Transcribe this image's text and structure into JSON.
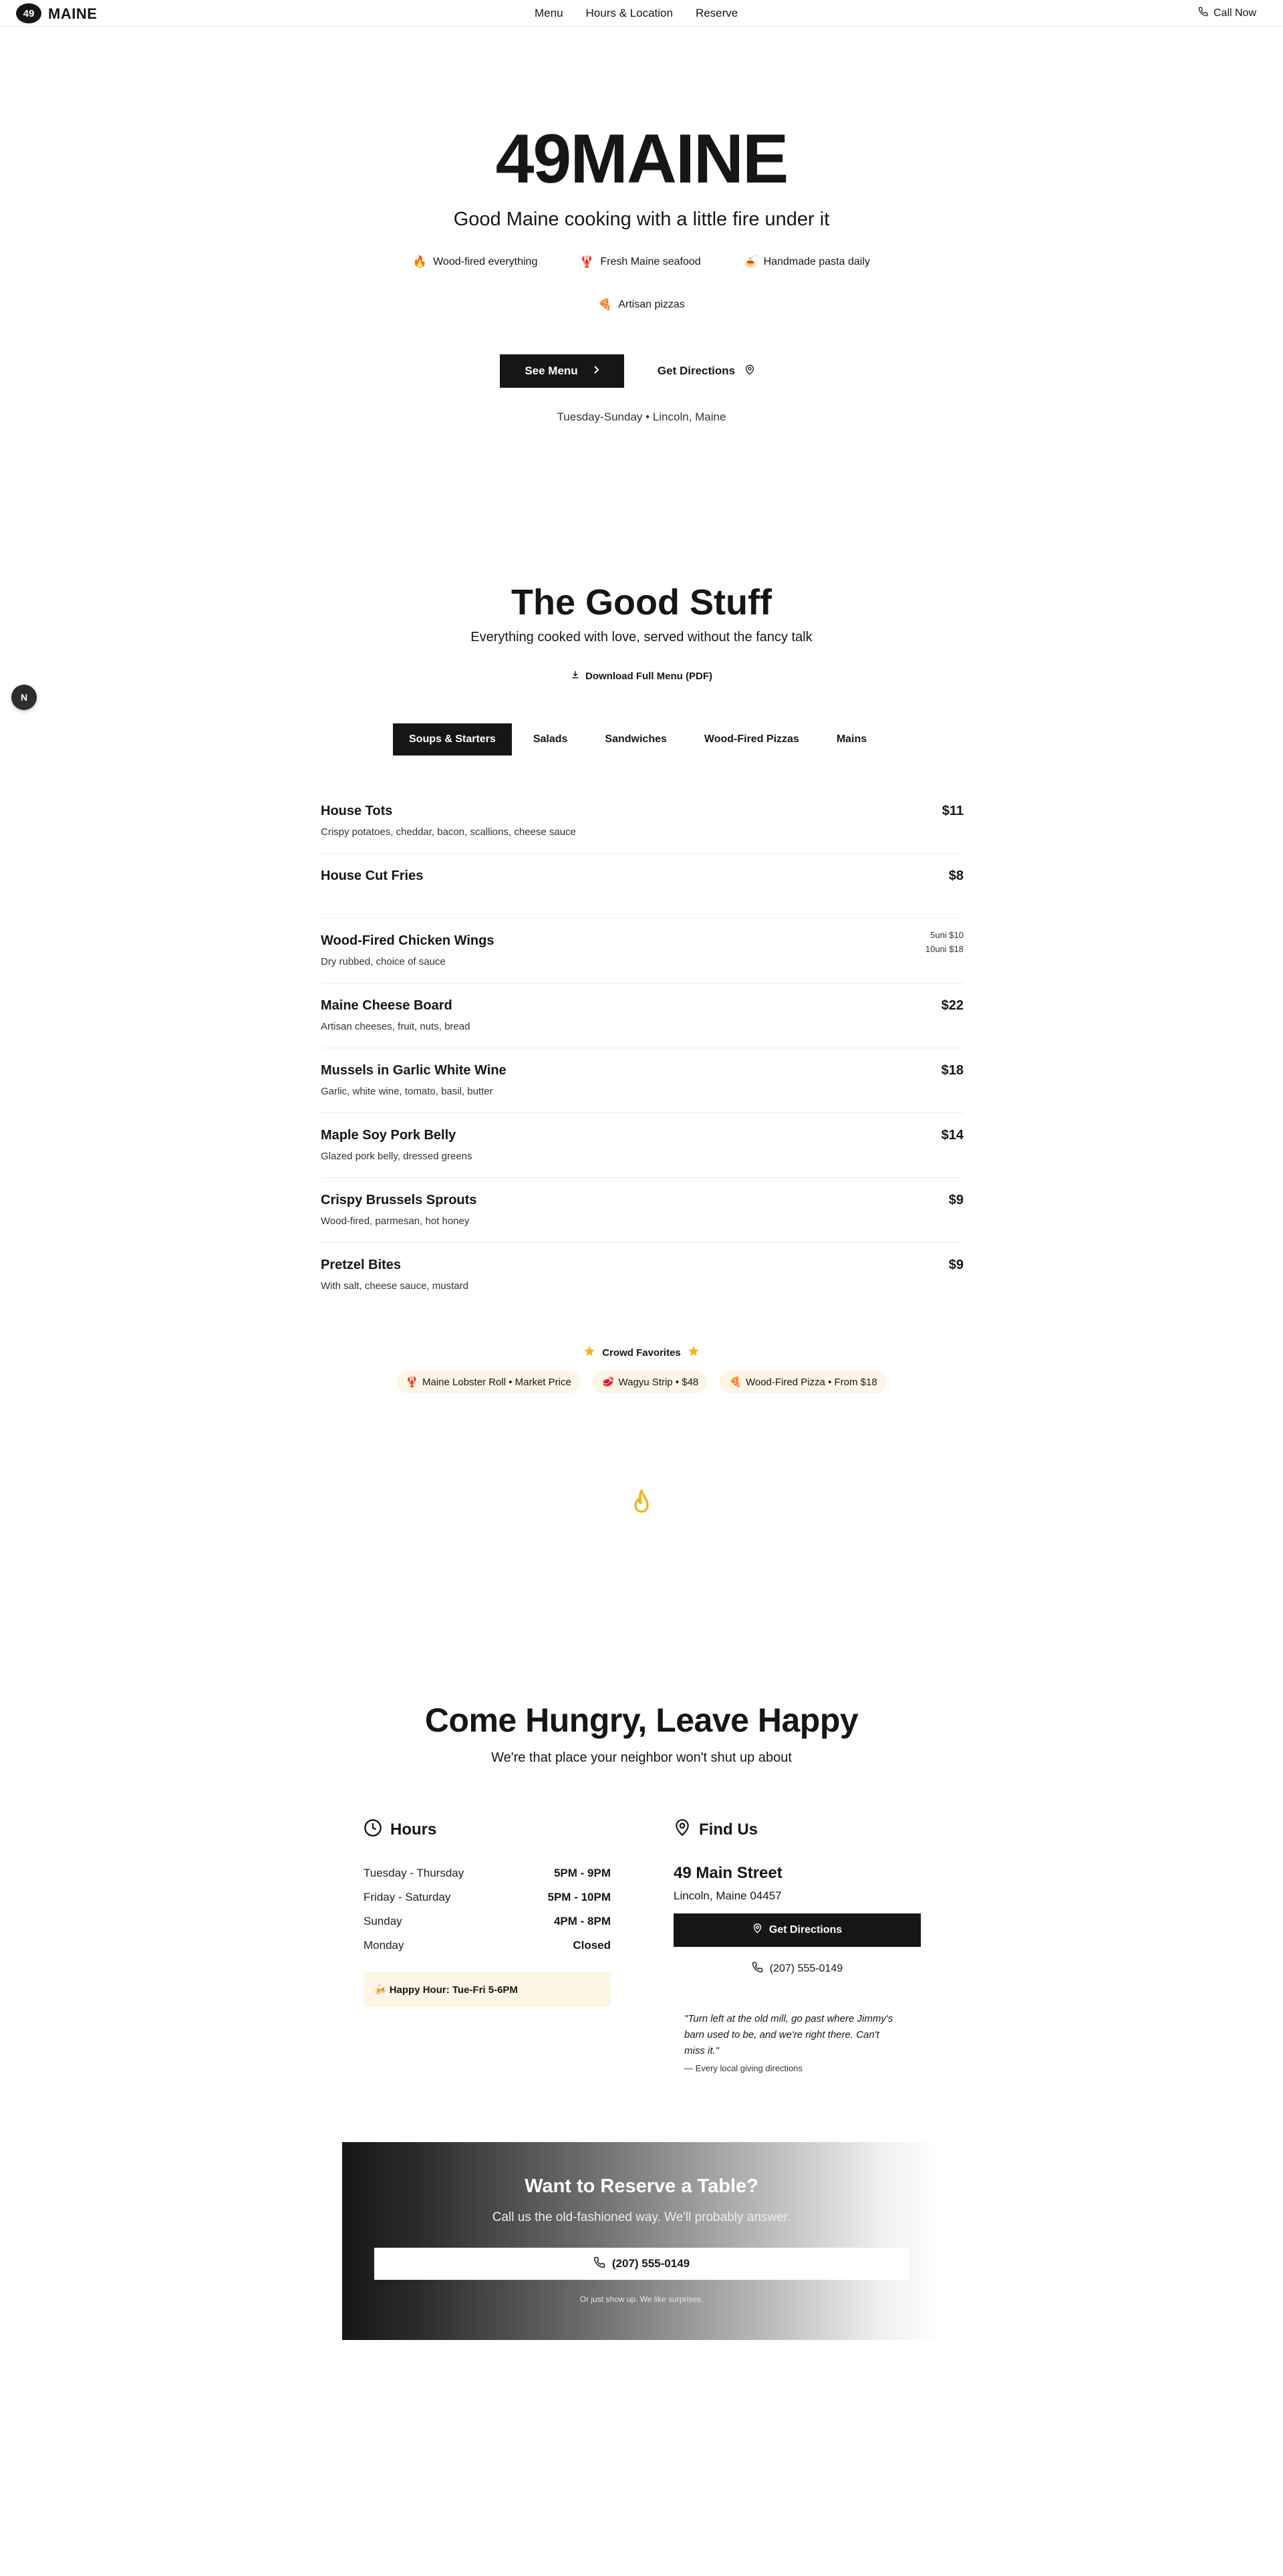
{
  "nav": {
    "logo_badge": "49",
    "logo_text": "MAINE",
    "links": [
      "Menu",
      "Hours & Location",
      "Reserve"
    ],
    "call": "Call Now"
  },
  "hero": {
    "title": "49MAINE",
    "tagline": "Good Maine cooking with a little fire under it",
    "features": [
      {
        "icon": "fire-icon",
        "glyph": "🔥",
        "label": "Wood-fired everything"
      },
      {
        "icon": "lobster-icon",
        "glyph": "🦞",
        "label": "Fresh Maine seafood"
      },
      {
        "icon": "pasta-icon",
        "glyph": "🍝",
        "label": "Handmade pasta daily"
      },
      {
        "icon": "pizza-icon",
        "glyph": "🍕",
        "label": "Artisan pizzas"
      }
    ],
    "see_menu": "See Menu",
    "get_directions": "Get Directions",
    "note": "Tuesday-Sunday • Lincoln, Maine"
  },
  "menu": {
    "title": "The Good Stuff",
    "subtitle": "Everything cooked with love, served without the fancy talk",
    "download": "Download Full Menu (PDF)",
    "side_badge": "N",
    "tabs": [
      "Soups & Starters",
      "Salads",
      "Sandwiches",
      "Wood-Fired Pizzas",
      "Mains"
    ],
    "active_tab": "Soups & Starters",
    "items": [
      {
        "name": "House Tots",
        "desc": "Crispy potatoes, cheddar, bacon, scallions, cheese sauce",
        "price": "$11"
      },
      {
        "name": "House Cut Fries",
        "desc": "",
        "price": "$8"
      },
      {
        "name": "Wood-Fired Chicken Wings",
        "desc": "Dry rubbed, choice of sauce",
        "price": "",
        "price_lines": [
          "5uni $10",
          "10uni $18"
        ]
      },
      {
        "name": "Maine Cheese Board",
        "desc": "Artisan cheeses, fruit, nuts, bread",
        "price": "$22"
      },
      {
        "name": "Mussels in Garlic White Wine",
        "desc": "Garlic, white wine, tomato, basil, butter",
        "price": "$18"
      },
      {
        "name": "Maple Soy Pork Belly",
        "desc": "Glazed pork belly, dressed greens",
        "price": "$14"
      },
      {
        "name": "Crispy Brussels Sprouts",
        "desc": "Wood-fired, parmesan, hot honey",
        "price": "$9"
      },
      {
        "name": "Pretzel Bites",
        "desc": "With salt, cheese sauce, mustard",
        "price": "$9"
      }
    ],
    "favorites_title": "Crowd Favorites",
    "favorites": [
      {
        "icon": "lobster-icon",
        "glyph": "🦞",
        "label": "Maine Lobster Roll • Market Price"
      },
      {
        "icon": "steak-icon",
        "glyph": "🥩",
        "label": "Wagyu Strip • $48"
      },
      {
        "icon": "pizza-icon",
        "glyph": "🍕",
        "label": "Wood-Fired Pizza • From $18"
      }
    ]
  },
  "visit": {
    "title": "Come Hungry, Leave Happy",
    "subtitle": "We're that place your neighbor won't shut up about",
    "hours_title": "Hours",
    "hours": [
      {
        "day": "Tuesday - Thursday",
        "time": "5PM - 9PM"
      },
      {
        "day": "Friday - Saturday",
        "time": "5PM - 10PM"
      },
      {
        "day": "Sunday",
        "time": "4PM - 8PM"
      },
      {
        "day": "Monday",
        "time": "Closed"
      }
    ],
    "happy_hour": "Happy Hour: Tue-Fri 5-6PM",
    "find_title": "Find Us",
    "address": "49 Main Street",
    "city": "Lincoln, Maine 04457",
    "directions": "Get Directions",
    "phone": "(207) 555-0149",
    "quote": "\"Turn left at the old mill, go past where Jimmy's barn used to be, and we're right there. Can't miss it.\"",
    "quote_by": "— Every local giving directions"
  },
  "cta": {
    "title": "Want to Reserve a Table?",
    "subtitle": "Call us the old-fashioned way. We'll probably answer.",
    "phone": "(207) 555-0149",
    "note": "Or just show up. We like surprises."
  },
  "colors": {
    "primary": "#161616",
    "accent_gold": "#f5b21a",
    "cream": "#fdf6e4",
    "fire": "#e8562a"
  }
}
